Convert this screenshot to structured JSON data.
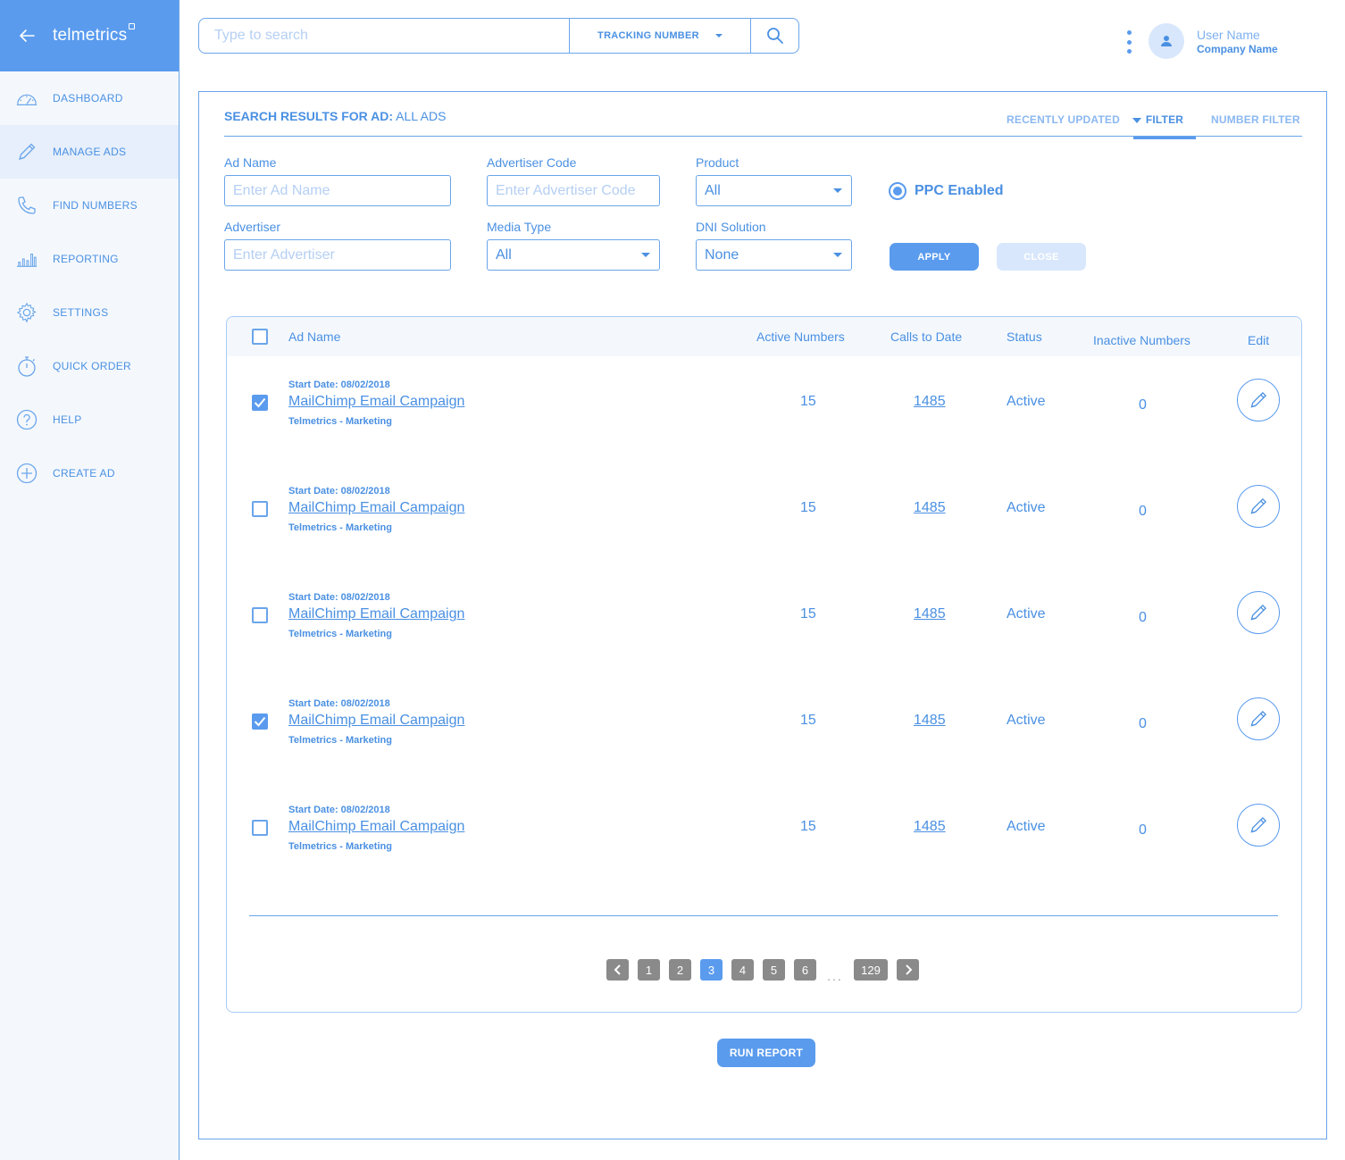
{
  "brand": {
    "name": "telmetrics"
  },
  "sidebar": {
    "items": [
      {
        "label": "DASHBOARD",
        "icon": "gauge-icon"
      },
      {
        "label": "MANAGE ADS",
        "icon": "pencil-icon",
        "active": true
      },
      {
        "label": "FIND NUMBERS",
        "icon": "phone-icon"
      },
      {
        "label": "REPORTING",
        "icon": "bar-chart-icon"
      },
      {
        "label": "SETTINGS",
        "icon": "gear-icon"
      },
      {
        "label": "QUICK ORDER",
        "icon": "stopwatch-icon"
      },
      {
        "label": "HELP",
        "icon": "help-icon"
      },
      {
        "label": "CREATE AD",
        "icon": "plus-circle-icon"
      }
    ]
  },
  "search": {
    "placeholder": "Type to search",
    "type_label": "TRACKING NUMBER"
  },
  "user": {
    "name": "User Name",
    "company": "Company Name"
  },
  "results": {
    "prefix": "SEARCH RESULTS FOR AD:",
    "value": "ALL ADS"
  },
  "tabs": {
    "recent": "RECENTLY UPDATED",
    "filter": "FILTER",
    "number": "NUMBER FILTER"
  },
  "filters": {
    "ad_name": {
      "label": "Ad Name",
      "placeholder": "Enter Ad Name"
    },
    "advertiser_code": {
      "label": "Advertiser Code",
      "placeholder": "Enter Advertiser Code"
    },
    "product": {
      "label": "Product",
      "value": "All"
    },
    "advertiser": {
      "label": "Advertiser",
      "placeholder": "Enter Advertiser"
    },
    "media_type": {
      "label": "Media Type",
      "value": "All"
    },
    "dni": {
      "label": "DNI Solution",
      "value": "None"
    },
    "ppc": {
      "label": "PPC Enabled",
      "selected": true
    },
    "apply": "APPLY",
    "close": "CLOSE"
  },
  "table": {
    "headers": {
      "ad_name": "Ad Name",
      "active": "Active Numbers",
      "calls": "Calls to Date",
      "status": "Status",
      "inactive": "Inactive Numbers",
      "edit": "Edit"
    },
    "rows": [
      {
        "checked": true,
        "start": "Start Date: 08/02/2018",
        "name": "MailChimp Email Campaign",
        "sub": "Telmetrics - Marketing",
        "active": "15",
        "calls": "1485",
        "status": "Active",
        "inactive": "0"
      },
      {
        "checked": false,
        "start": "Start Date: 08/02/2018",
        "name": "MailChimp Email Campaign",
        "sub": "Telmetrics - Marketing",
        "active": "15",
        "calls": "1485",
        "status": "Active",
        "inactive": "0"
      },
      {
        "checked": false,
        "start": "Start Date: 08/02/2018",
        "name": "MailChimp Email Campaign",
        "sub": "Telmetrics - Marketing",
        "active": "15",
        "calls": "1485",
        "status": "Active",
        "inactive": "0"
      },
      {
        "checked": true,
        "start": "Start Date: 08/02/2018",
        "name": "MailChimp Email Campaign",
        "sub": "Telmetrics - Marketing",
        "active": "15",
        "calls": "1485",
        "status": "Active",
        "inactive": "0"
      },
      {
        "checked": false,
        "start": "Start Date: 08/02/2018",
        "name": "MailChimp Email Campaign",
        "sub": "Telmetrics - Marketing",
        "active": "15",
        "calls": "1485",
        "status": "Active",
        "inactive": "0"
      }
    ]
  },
  "pagination": {
    "pages": [
      "1",
      "2",
      "3",
      "4",
      "5",
      "6"
    ],
    "current": "3",
    "ellipsis": "...",
    "last": "129"
  },
  "run_report": "RUN REPORT",
  "colors": {
    "accent": "#5a9bee",
    "text": "#4a90e2",
    "light": "#f4f8fd"
  }
}
